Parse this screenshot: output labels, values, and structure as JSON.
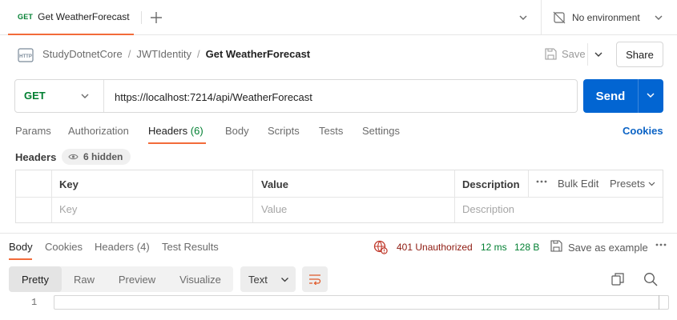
{
  "colors": {
    "accent": "#f26b3a",
    "send": "#0265d2",
    "get": "#007f31",
    "error": "#8e1a10",
    "link": "#0b63c5"
  },
  "tab": {
    "method": "GET",
    "title": "Get WeatherForecast"
  },
  "environment": {
    "label": "No environment"
  },
  "breadcrumb": {
    "parts": [
      "StudyDotnetCore",
      "JWTIdentity",
      "Get WeatherForecast"
    ]
  },
  "toolbar": {
    "save_label": "Save",
    "share_label": "Share"
  },
  "request": {
    "method": "GET",
    "url": "https://localhost:7214/api/WeatherForecast",
    "send_label": "Send",
    "tabs": [
      "Params",
      "Authorization",
      "Headers",
      "Body",
      "Scripts",
      "Tests",
      "Settings"
    ],
    "headers_count": "(6)",
    "cookies_label": "Cookies"
  },
  "headers": {
    "label": "Headers",
    "hidden_label": "6 hidden",
    "columns": [
      "Key",
      "Value",
      "Description"
    ],
    "placeholders": [
      "Key",
      "Value",
      "Description"
    ],
    "bulk_edit": "Bulk Edit",
    "presets": "Presets"
  },
  "response": {
    "tabs": [
      "Body",
      "Cookies",
      "Headers",
      "Test Results"
    ],
    "headers_count": "(4)",
    "status": "401 Unauthorized",
    "time": "12 ms",
    "size": "128 B",
    "save_example": "Save as example",
    "formats": [
      "Pretty",
      "Raw",
      "Preview",
      "Visualize"
    ],
    "language": "Text",
    "line_number": "1"
  }
}
